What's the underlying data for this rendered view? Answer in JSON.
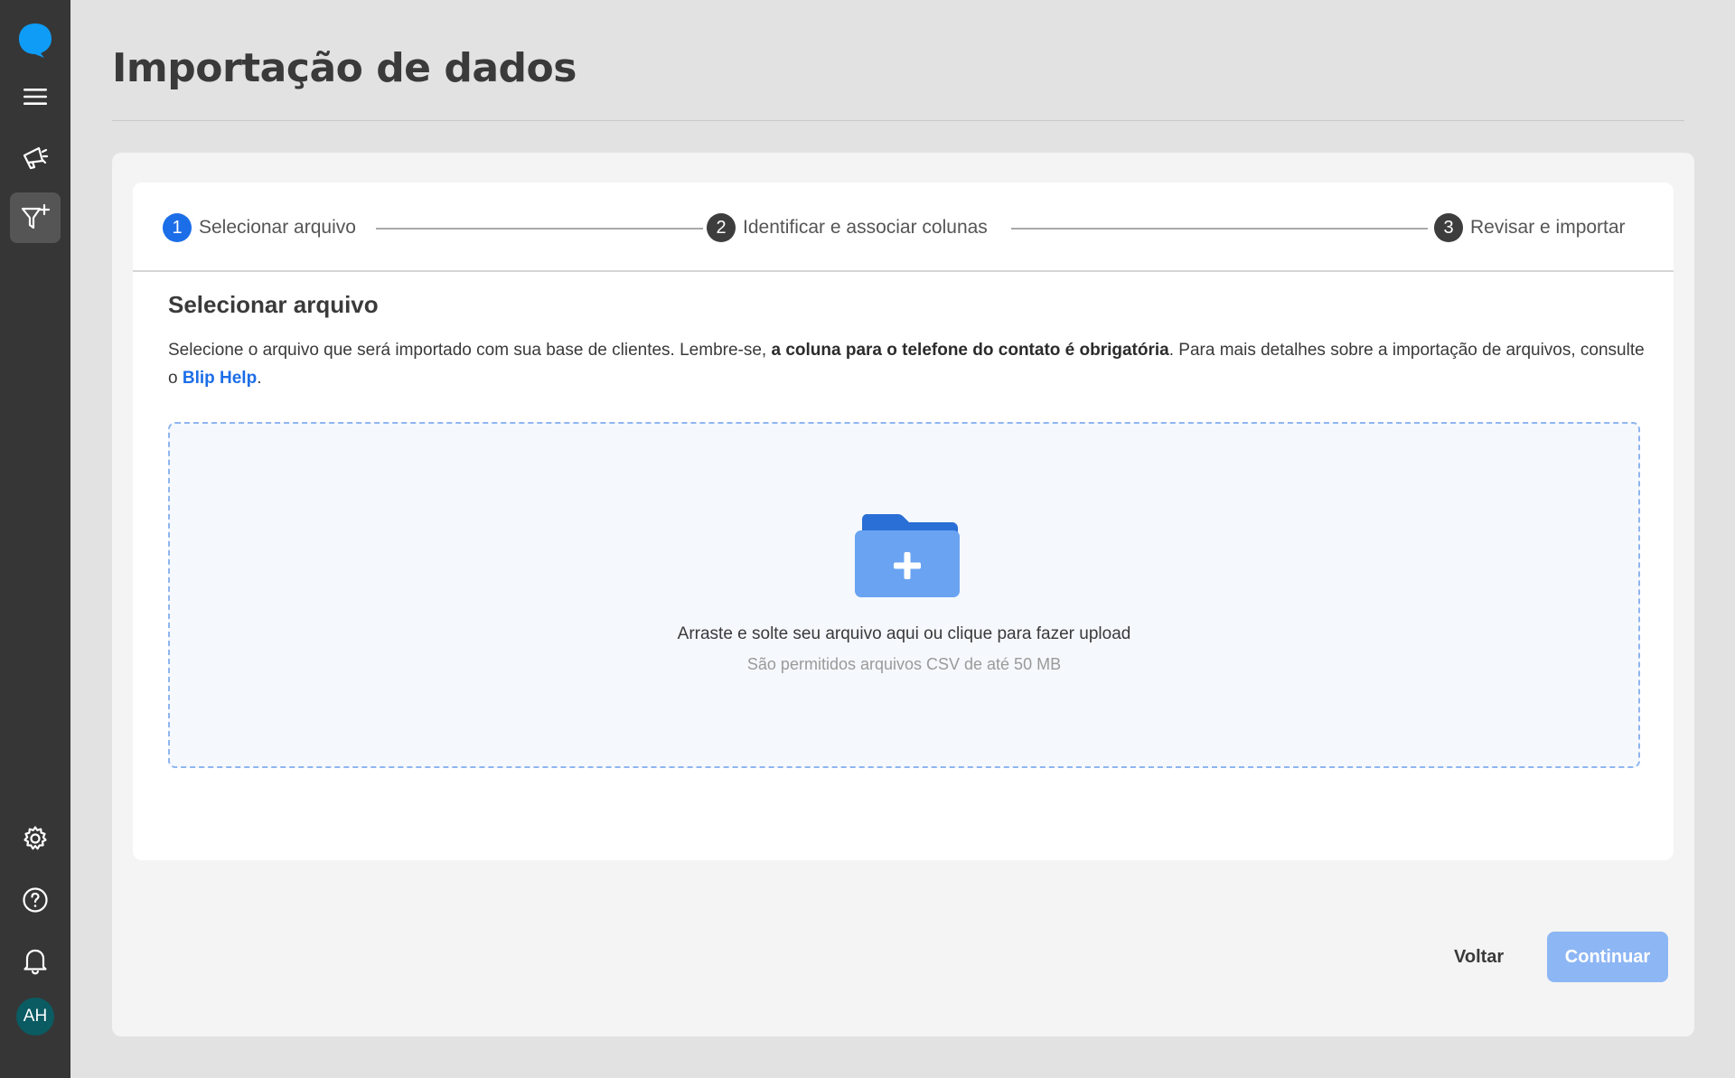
{
  "sidebar": {
    "logo_icon": "blip-chat-bubble-icon",
    "items": [
      {
        "icon": "menu-icon"
      },
      {
        "icon": "megaphone-icon"
      },
      {
        "icon": "filter-plus-icon",
        "active": true
      }
    ],
    "bottom_items": [
      {
        "icon": "gear-icon"
      },
      {
        "icon": "help-icon"
      },
      {
        "icon": "bell-icon"
      }
    ],
    "avatar_initials": "AH"
  },
  "header": {
    "title": "Importação de dados"
  },
  "stepper": {
    "steps": [
      {
        "number": "1",
        "label": "Selecionar arquivo",
        "active": true
      },
      {
        "number": "2",
        "label": "Identificar e associar colunas",
        "active": false
      },
      {
        "number": "3",
        "label": "Revisar e importar",
        "active": false
      }
    ]
  },
  "content": {
    "section_title": "Selecionar arquivo",
    "description_prefix": "Selecione o arquivo que será importado com sua base de clientes. Lembre-se, ",
    "description_bold": "a coluna para o telefone do contato é obrigatória",
    "description_middle": ". Para mais detalhes sobre a importação de arquivos, consulte o ",
    "description_link": "Blip Help",
    "description_suffix": "."
  },
  "dropzone": {
    "icon": "folder-plus-icon",
    "main_text": "Arraste e solte seu arquivo aqui ou clique para fazer upload",
    "sub_text": "São permitidos arquivos CSV de até 50 MB"
  },
  "footer": {
    "back_label": "Voltar",
    "continue_label": "Continuar"
  },
  "colors": {
    "accent": "#1c6ee8",
    "sidebar_bg": "#363636",
    "continue_disabled": "#8db6f4"
  }
}
